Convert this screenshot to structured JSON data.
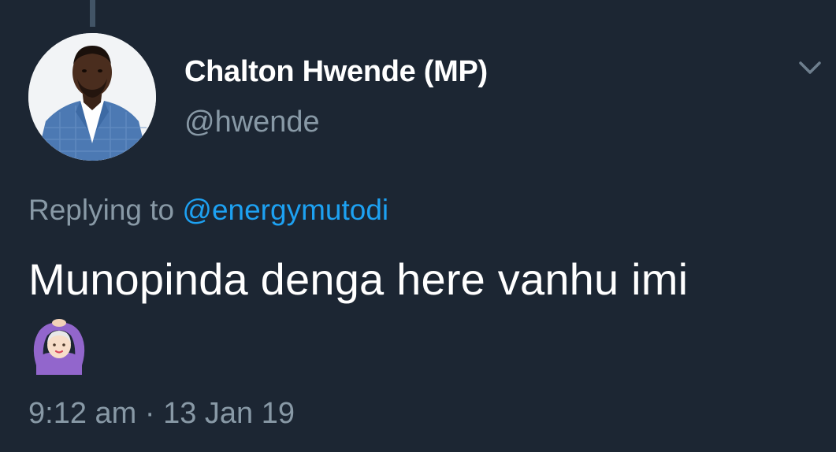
{
  "tweet": {
    "author": {
      "display_name": "Chalton Hwende (MP)",
      "handle": "@hwende",
      "avatar_icon": "profile-photo"
    },
    "reply": {
      "prefix": "Replying to",
      "mention": "@energymutodi"
    },
    "text": "Munopinda denga here vanhu imi",
    "emoji": "person-gesturing-ok-emoji",
    "timestamp": "9:12 am · 13 Jan 19",
    "menu_icon": "chevron-down-icon"
  },
  "colors": {
    "background": "#1c2633",
    "primary_text": "#ffffff",
    "secondary_text": "#8899a6",
    "link": "#1da1f2",
    "thread_line": "#425466"
  }
}
